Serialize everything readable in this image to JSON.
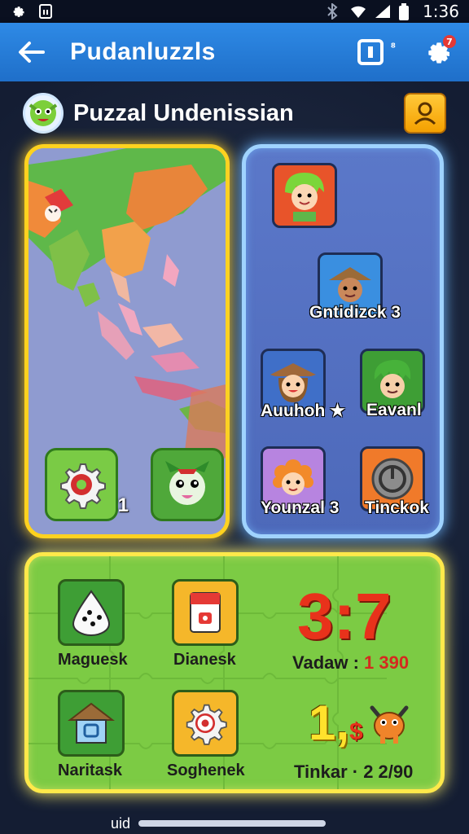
{
  "status_bar": {
    "time": "1:36"
  },
  "app_bar": {
    "title": "Pudanluzzls",
    "menu_badge_glyph": "⁸",
    "settings_badge": "7"
  },
  "header": {
    "title": "Puzzal Undenissian"
  },
  "map_panel": {
    "tile_number": "1"
  },
  "characters": [
    {
      "label": "",
      "color": "#e8542a"
    },
    {
      "label": "Gntidizck 3",
      "color": "#3a8fe0"
    },
    {
      "label": "Auuhoh ★",
      "color": "#3f6fc8"
    },
    {
      "label": "Eavanl",
      "color": "#3e9e35"
    },
    {
      "label": "Younzal 3",
      "color": "#b784e0"
    },
    {
      "label": "Tinckok",
      "color": "#f07a2a"
    }
  ],
  "bottom_tiles": [
    {
      "label": "Maguesk",
      "icon": "dice-drop-icon"
    },
    {
      "label": "Dianesk",
      "icon": "card-icon"
    },
    {
      "label": "Naritask",
      "icon": "hut-icon"
    },
    {
      "label": "Soghenek",
      "icon": "gear-icon"
    }
  ],
  "scores": {
    "big_score": "3:7",
    "vadaw_label": "Vadaw :",
    "vadaw_value": "1 390",
    "big_yellow": "1,",
    "big_yellow_sub": "$",
    "tinkar_label": "Tinkar ·",
    "tinkar_value": "2 2/90"
  },
  "footer": {
    "label": "uid"
  },
  "colors": {
    "appbar": "#2e8ae6",
    "map_border": "#ffd21f",
    "char_border": "#9fd3ff",
    "bottom_border": "#ffe94a",
    "bottom_bg": "#7ccb44"
  }
}
